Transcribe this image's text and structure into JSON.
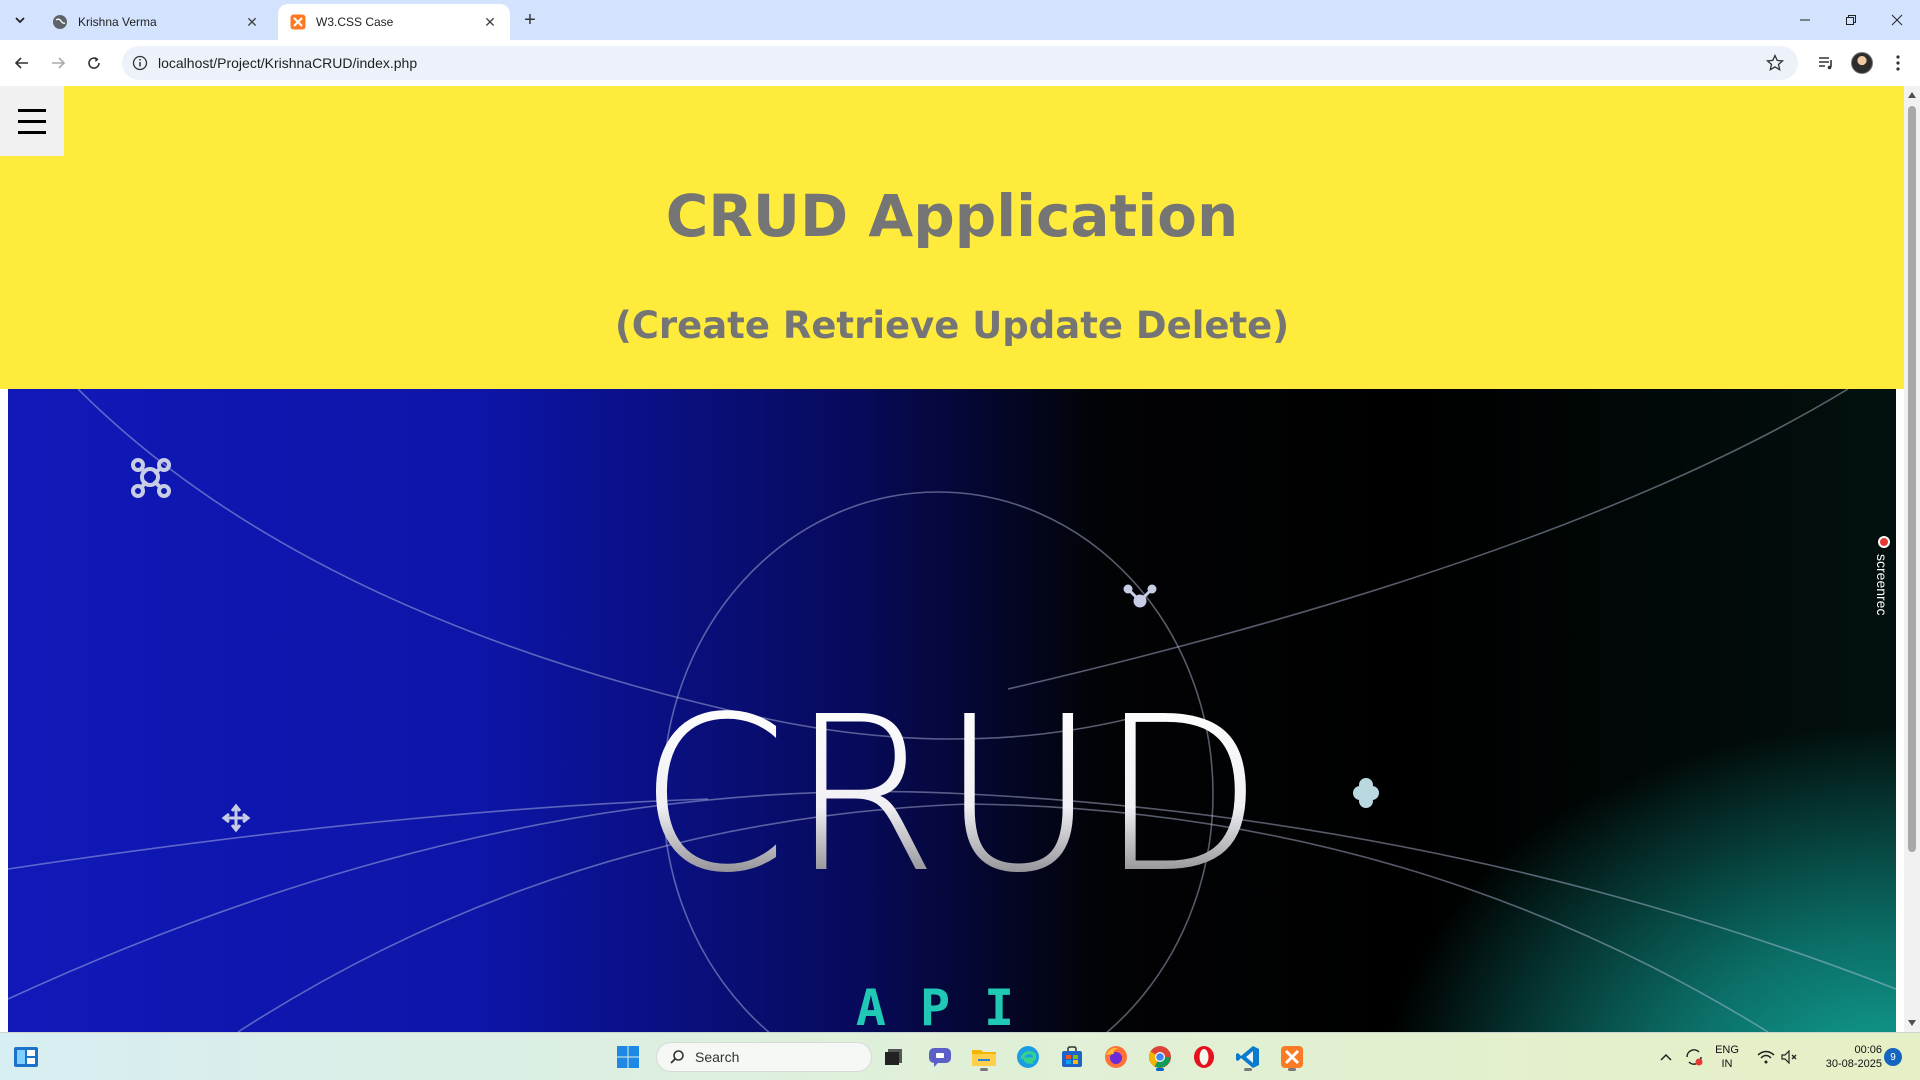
{
  "browser": {
    "tabs": [
      {
        "title": "Krishna Verma",
        "active": false
      },
      {
        "title": "W3.CSS Case",
        "active": true
      }
    ],
    "url": "localhost/Project/KrishnaCRUD/index.php"
  },
  "page": {
    "header_bg": "#ffeb3b",
    "title": "CRUD Application",
    "subtitle": "(Create Retrieve Update Delete)",
    "hero": {
      "big_text": "CRUD",
      "small_text": "API"
    }
  },
  "overlay": {
    "screenrec_label": "screenrec"
  },
  "taskbar": {
    "search_placeholder": "Search",
    "language_line1": "ENG",
    "language_line2": "IN",
    "time": "00:06",
    "date": "30-08-2025",
    "notification_count": "9"
  }
}
